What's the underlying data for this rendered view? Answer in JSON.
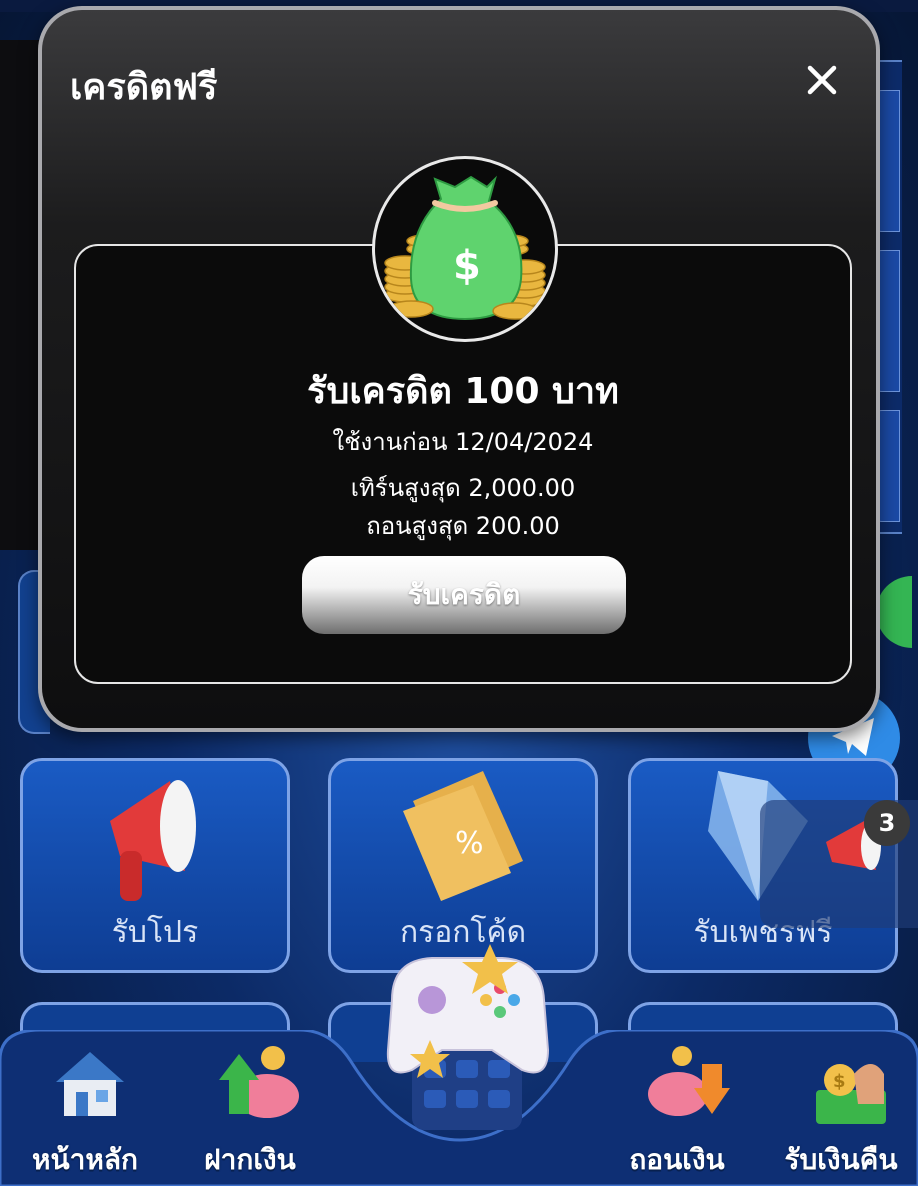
{
  "modal": {
    "title": "เครดิตฟรี",
    "credit_title": "รับเครดิต 100 บาท",
    "expiry": "ใช้งานก่อน 12/04/2024",
    "max_turnover": "เทิร์นสูงสุด 2,000.00",
    "max_withdraw": "ถอนสูงสุด 200.00",
    "claim_button": "รับเครดิต"
  },
  "menu_cards": [
    {
      "label": "รับโปร",
      "icon": "megaphone-icon"
    },
    {
      "label": "กรอกโค้ด",
      "icon": "coupon-icon"
    },
    {
      "label": "รับเพชรฟรี",
      "icon": "diamond-icon"
    }
  ],
  "notification": {
    "count": "3"
  },
  "bottom_nav": [
    {
      "label": "หน้าหลัก",
      "icon": "house-icon"
    },
    {
      "label": "ฝากเงิน",
      "icon": "piggy-bank-deposit-icon"
    },
    {
      "label": "ถอนเงิน",
      "icon": "piggy-bank-withdraw-icon"
    },
    {
      "label": "รับเงินคืน",
      "icon": "cashback-icon"
    }
  ],
  "colors": {
    "background": "#0c2a66",
    "card": "#1a5bc4",
    "modal": "#1c1c1d",
    "claim_button": "#f3f3f3"
  }
}
